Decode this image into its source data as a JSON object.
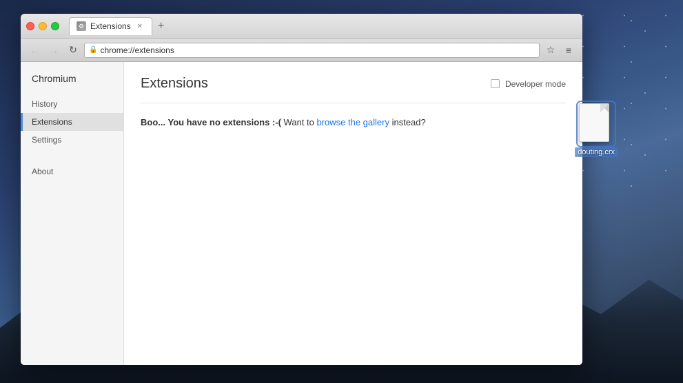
{
  "desktop": {
    "file": {
      "name": "douting.crx",
      "icon": "document"
    }
  },
  "browser": {
    "tab": {
      "label": "Extensions",
      "icon": "puzzle"
    },
    "address": "chrome://extensions",
    "nav": {
      "back": "←",
      "forward": "→",
      "reload": "↻",
      "bookmark": "☆",
      "menu": "≡"
    }
  },
  "sidebar": {
    "brand": "Chromium",
    "items": [
      {
        "id": "history",
        "label": "History"
      },
      {
        "id": "extensions",
        "label": "Extensions",
        "active": true
      },
      {
        "id": "settings",
        "label": "Settings"
      }
    ],
    "bottom_items": [
      {
        "id": "about",
        "label": "About"
      }
    ]
  },
  "main": {
    "title": "Extensions",
    "developer_mode_label": "Developer mode",
    "empty_message_prefix": "Boo... You have no extensions :-(",
    "empty_message_middle": "  Want to ",
    "gallery_link_text": "browse the gallery",
    "empty_message_suffix": " instead?"
  }
}
